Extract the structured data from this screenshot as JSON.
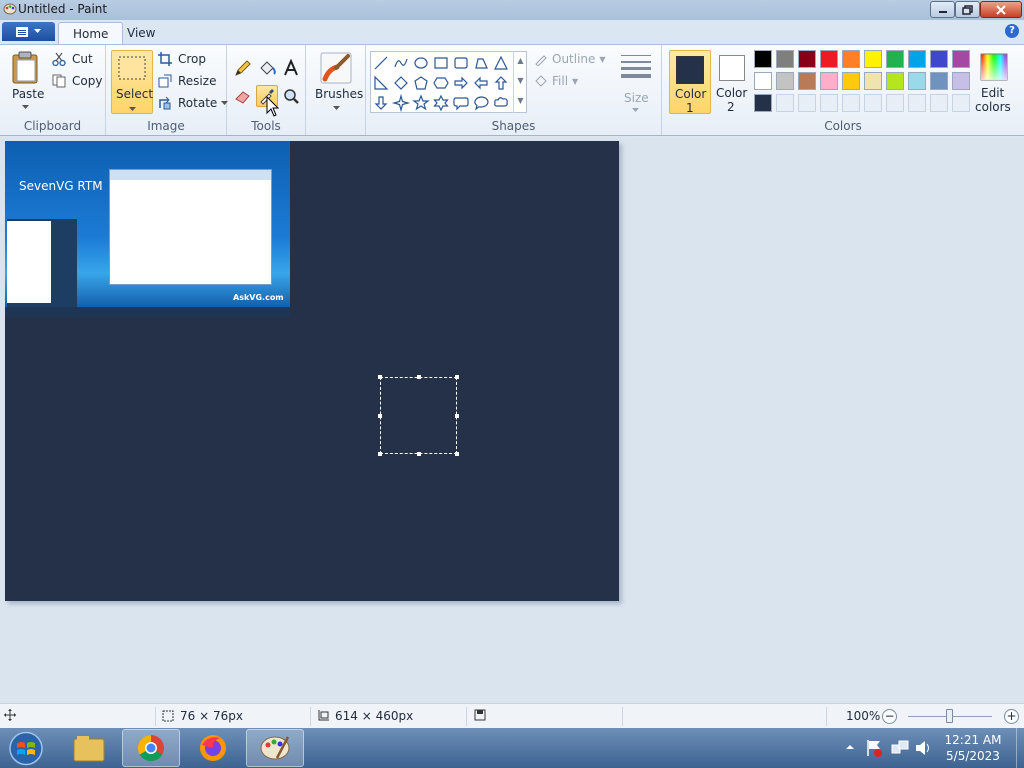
{
  "window": {
    "title": "Untitled - Paint"
  },
  "tabs": [
    {
      "label": "Home"
    },
    {
      "label": "View"
    }
  ],
  "clipboard": {
    "paste": "Paste",
    "cut": "Cut",
    "copy": "Copy",
    "group": "Clipboard"
  },
  "image": {
    "select": "Select",
    "crop": "Crop",
    "resize": "Resize",
    "rotate": "Rotate",
    "group": "Image"
  },
  "tools": {
    "group": "Tools",
    "brushes": "Brushes"
  },
  "shapes": {
    "group": "Shapes",
    "outline": "Outline",
    "fill": "Fill",
    "size": "Size"
  },
  "colors": {
    "color1_label": "Color",
    "color1_num": "1",
    "color2_label": "Color",
    "color2_num": "2",
    "edit_label": "Edit",
    "edit_label2": "colors",
    "group": "Colors",
    "color1": "#243149",
    "color2": "#ffffff",
    "palette": [
      "#000000",
      "#7f7f7f",
      "#880015",
      "#ed1c24",
      "#ff7f27",
      "#fff200",
      "#22b14c",
      "#00a2e8",
      "#3f48cc",
      "#a349a4",
      "#ffffff",
      "#c3c3c3",
      "#b97a57",
      "#ffaec9",
      "#ffc90e",
      "#efe4b0",
      "#b5e61d",
      "#99d9ea",
      "#7092be",
      "#c8bfe7"
    ],
    "custom": [
      "#243149"
    ]
  },
  "canvas": {
    "background": "#243149",
    "thumbnail_brand": "SevenVG RTM",
    "thumbnail_site": "AskVG.com"
  },
  "status": {
    "selection_size": "76 × 76px",
    "canvas_size": "614 × 460px",
    "zoom": "100%",
    "zoom_level": 0.5
  },
  "taskbar": {
    "time": "12:21 AM",
    "date": "5/5/2023"
  }
}
